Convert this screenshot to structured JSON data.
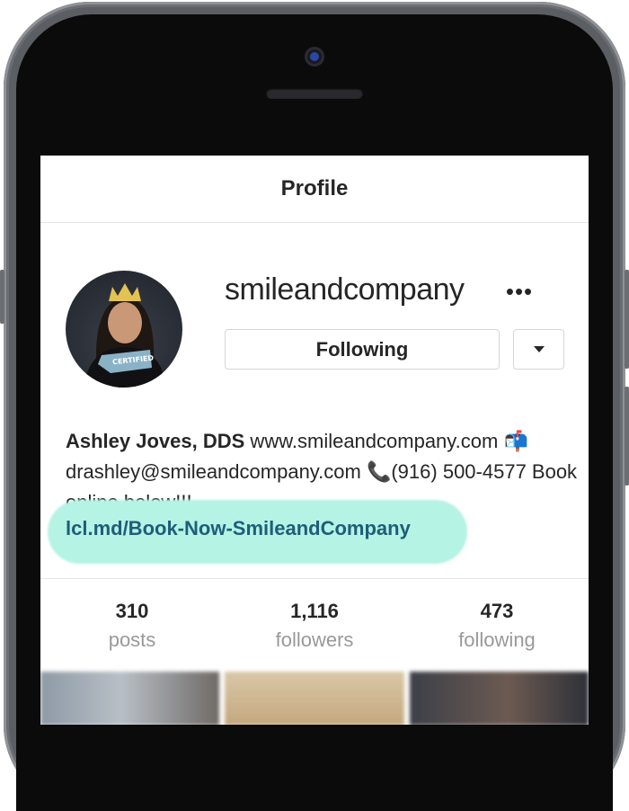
{
  "screen": {
    "title": "Profile"
  },
  "profile": {
    "username": "smileandcompany",
    "more_icon": "more-icon",
    "following_button": "Following",
    "dropdown_icon": "caret-down-icon",
    "avatar_sign_text": "CERTIFIED"
  },
  "bio": {
    "name": "Ashley Joves, DDS",
    "text_1": " www.smileandcompany.com ",
    "mailbox_glyph": "📬",
    "text_2": "drashley@smileandcompany.com ",
    "phone_glyph": "📞",
    "text_3": "(916) 500-4577 Book online below!!!",
    "link": "lcl.md/Book-Now-SmileandCompany",
    "link_highlight_color": "#b5f3e4"
  },
  "stats": [
    {
      "count": "310",
      "label": "posts"
    },
    {
      "count": "1,116",
      "label": "followers"
    },
    {
      "count": "473",
      "label": "following"
    }
  ]
}
